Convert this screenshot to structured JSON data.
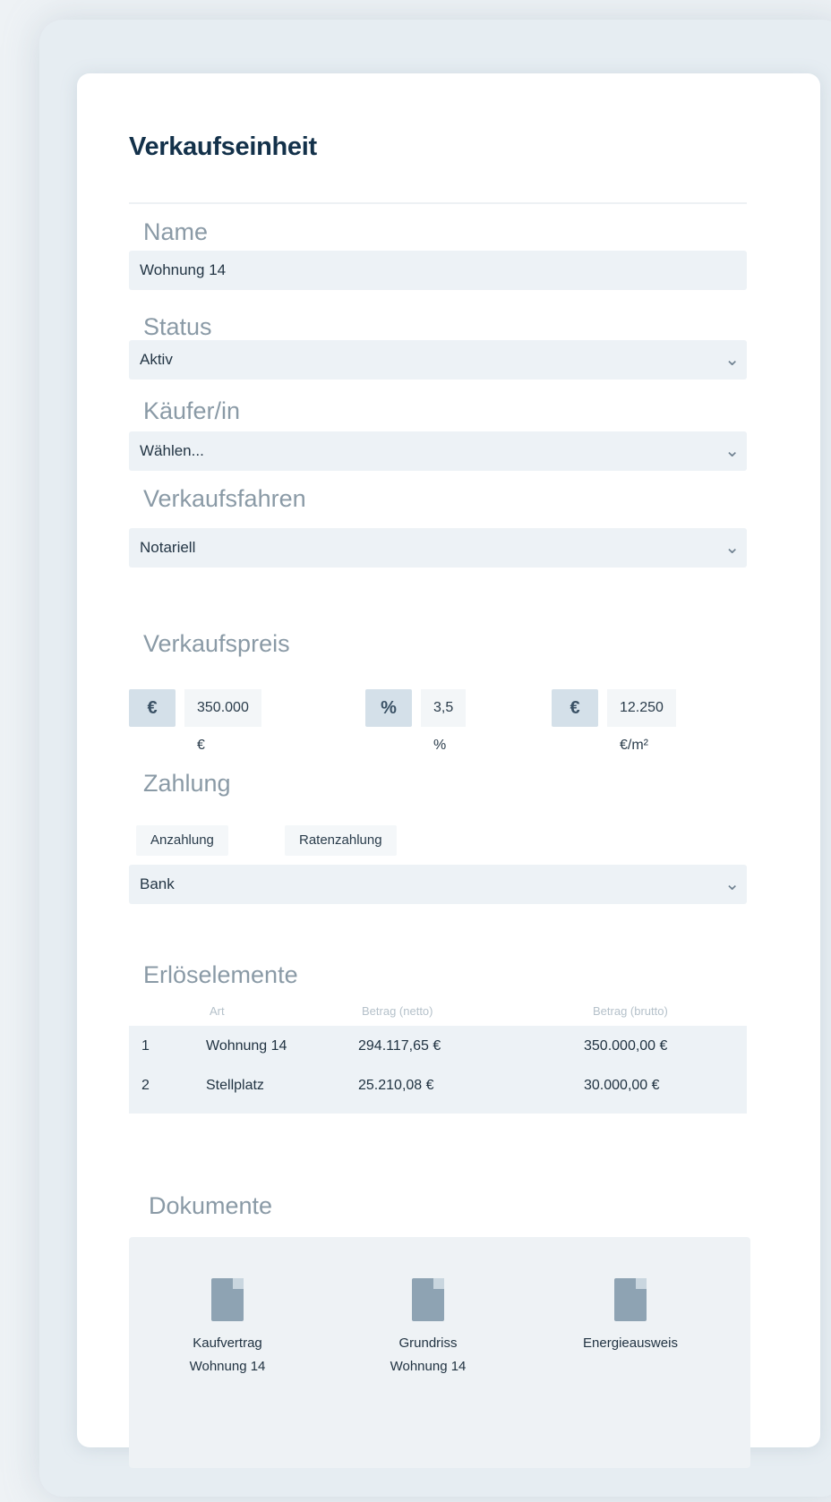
{
  "card": {
    "title": "Verkaufseinheit"
  },
  "fields": {
    "name": {
      "label": "Name",
      "value": "Wohnung 14"
    },
    "status": {
      "label": "Status",
      "value": "Aktiv"
    },
    "kaeufer": {
      "label": "Käufer/in",
      "value": "Wählen..."
    },
    "verfahren": {
      "label": "Verkaufsfahren",
      "value": "Notariell"
    }
  },
  "verkaufspreis": {
    "label": "Verkaufspreis",
    "items": [
      {
        "icon": "€",
        "value": "350.000 €"
      },
      {
        "icon": "%",
        "value": "3,5 %"
      },
      {
        "icon": "€",
        "value": "12.250 €/m²"
      }
    ]
  },
  "zahlung": {
    "label": "Zahlung",
    "chips": [
      "Anzahlung",
      "Ratenzahlung"
    ],
    "value": "Bank"
  },
  "erloes": {
    "label": "Erlöselemente",
    "headers": [
      "Art",
      "Betrag (netto)",
      "Betrag (brutto)"
    ],
    "rows": [
      {
        "num": "1",
        "art": "Wohnung 14",
        "netto": "294.117,65 €",
        "brutto": "350.000,00 €"
      },
      {
        "num": "2",
        "art": "Stellplatz",
        "netto": "25.210,08 €",
        "brutto": "30.000,00 €"
      }
    ]
  },
  "dokumente": {
    "label": "Dokumente",
    "files": [
      {
        "line1": "Kaufvertrag",
        "line2": "Wohnung 14"
      },
      {
        "line1": "Grundriss",
        "line2": "Wohnung 14"
      },
      {
        "line1": "Energieausweis",
        "line2": ""
      }
    ]
  },
  "icons": {
    "chevron": "chevron-down-icon",
    "file": "file-icon"
  }
}
